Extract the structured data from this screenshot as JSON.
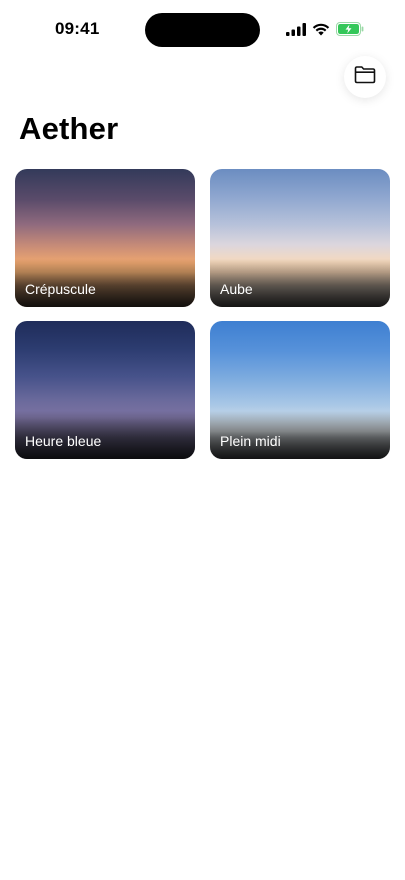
{
  "status_bar": {
    "time": "09:41",
    "icons": [
      "cellular-signal-icon",
      "wifi-icon",
      "battery-charging-icon"
    ],
    "battery_color": "#34c759"
  },
  "header": {
    "folder_button_icon": "folder-icon",
    "title": "Aether"
  },
  "cards": [
    {
      "label": "Crépuscule",
      "gradient": [
        "#333a5a",
        "#8f6a7e",
        "#eda670",
        "#7c6452"
      ]
    },
    {
      "label": "Aube",
      "gradient": [
        "#6b8dc1",
        "#b6c1da",
        "#f6d9bc",
        "#8b8682"
      ]
    },
    {
      "label": "Heure bleue",
      "gradient": [
        "#1f2c5a",
        "#46528a",
        "#7c73a2",
        "#4c4a5e"
      ]
    },
    {
      "label": "Plein midi",
      "gradient": [
        "#3e7fd1",
        "#7eacdf",
        "#dfe6ea",
        "#7a7d80"
      ]
    }
  ]
}
